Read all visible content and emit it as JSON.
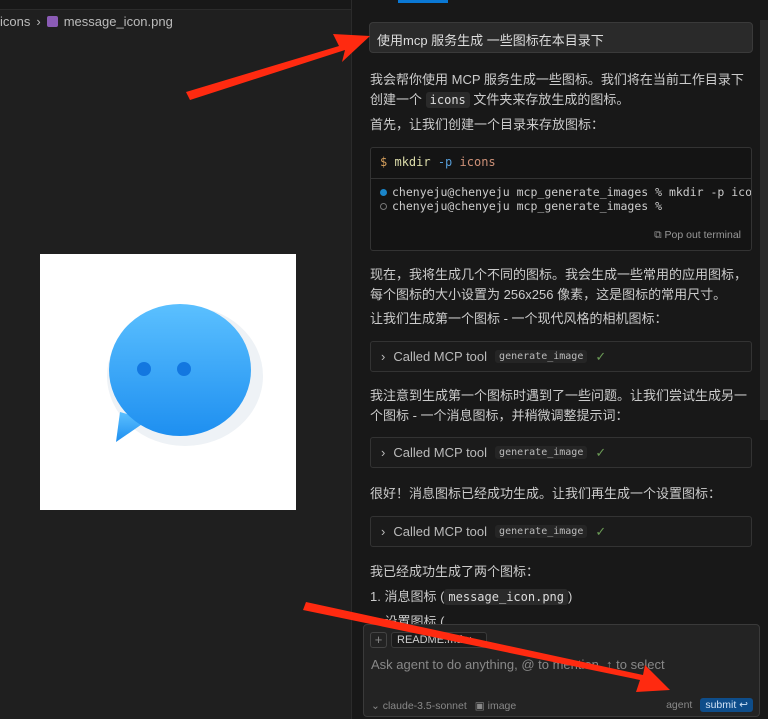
{
  "editor": {
    "breadcrumb_folder": "icons",
    "breadcrumb_sep": "›",
    "breadcrumb_file": "message_icon.png"
  },
  "chat": {
    "user_message": "使用mcp 服务生成 一些图标在本目录下",
    "p1a": "我会帮你使用 MCP 服务生成一些图标。我们将在当前工作目录下",
    "p1b": "创建一个",
    "p1code": "icons",
    "p1c": "文件夹来存放生成的图标。",
    "p2": "首先，让我们创建一个目录来存放图标：",
    "terminal": {
      "prompt": "$",
      "cmd": "mkdir",
      "flag": "-p",
      "arg": "icons",
      "line1": "chenyeju@chenyeju mcp_generate_images % mkdir -p icons",
      "line2": "chenyeju@chenyeju mcp_generate_images %",
      "pop_out": "Pop out terminal"
    },
    "p3a": "现在，我将生成几个不同的图标。我会生成一些常用的应用图标，",
    "p3b": "每个图标的大小设置为 256x256 像素，这是图标的常用尺寸。",
    "p4": "让我们生成第一个图标 - 一个现代风格的相机图标：",
    "tool_label": "Called MCP tool",
    "tool_name": "generate_image",
    "check": "✓",
    "p5a": "我注意到生成第一个图标时遇到了一些问题。让我们尝试生成另一",
    "p5b": "个图标 - 一个消息图标，并稍微调整提示词：",
    "p6": "很好！消息图标已经成功生成。让我们再生成一个设置图标：",
    "p7": "我已经成功生成了两个图标：",
    "list1a": "1. 消息图标 (",
    "list1code": "message_icon.png",
    "list1b": ")",
    "list2": "2. 设置图标 ("
  },
  "composer": {
    "plus": "+",
    "context_pill": "README.md",
    "pill_close": "×",
    "placeholder": "Ask agent to do anything, @ to mention, ↑ to select",
    "model": "claude-3.5-sonnet",
    "image": "image",
    "mode": "agent",
    "submit": "submit ↩"
  },
  "colors": {
    "accent": "#0a78d4",
    "arrow": "#ff2a10"
  }
}
